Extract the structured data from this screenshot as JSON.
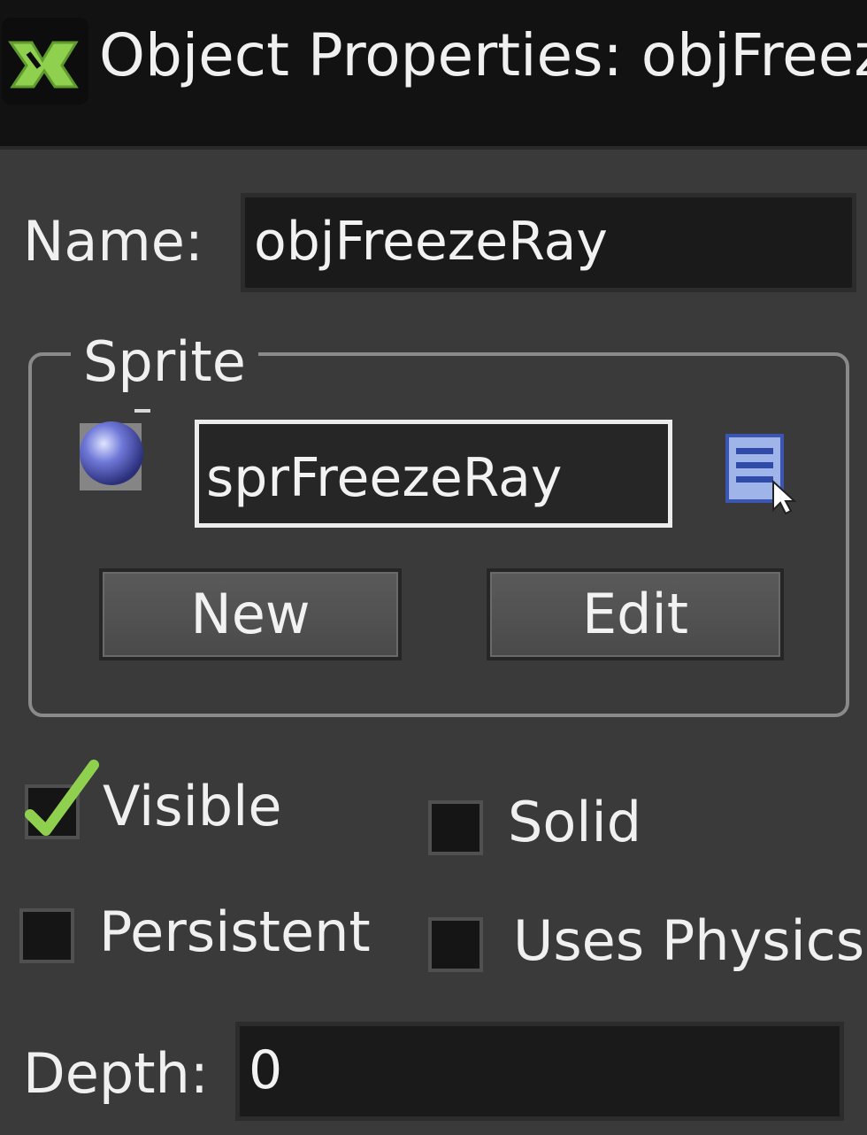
{
  "window": {
    "title": "Object Properties: objFreez"
  },
  "name": {
    "label": "Name:",
    "value": "objFreezeRay"
  },
  "sprite": {
    "group_label": "Sprite",
    "value": "sprFreezeRay",
    "new_label": "New",
    "edit_label": "Edit",
    "preview_icon": "sprite-preview-icon",
    "picker_icon": "sprite-menu-icon"
  },
  "options": {
    "visible": {
      "label": "Visible",
      "checked": true
    },
    "solid": {
      "label": "Solid",
      "checked": false
    },
    "persistent": {
      "label": "Persistent",
      "checked": false
    },
    "uses_physics": {
      "label": "Uses Physics",
      "checked": false
    }
  },
  "depth": {
    "label": "Depth:",
    "value": "0"
  },
  "colors": {
    "background": "#3a3a3a",
    "titlebar": "#121212",
    "accent_green": "#8fd14f",
    "field_bg": "#1a1a1a"
  }
}
